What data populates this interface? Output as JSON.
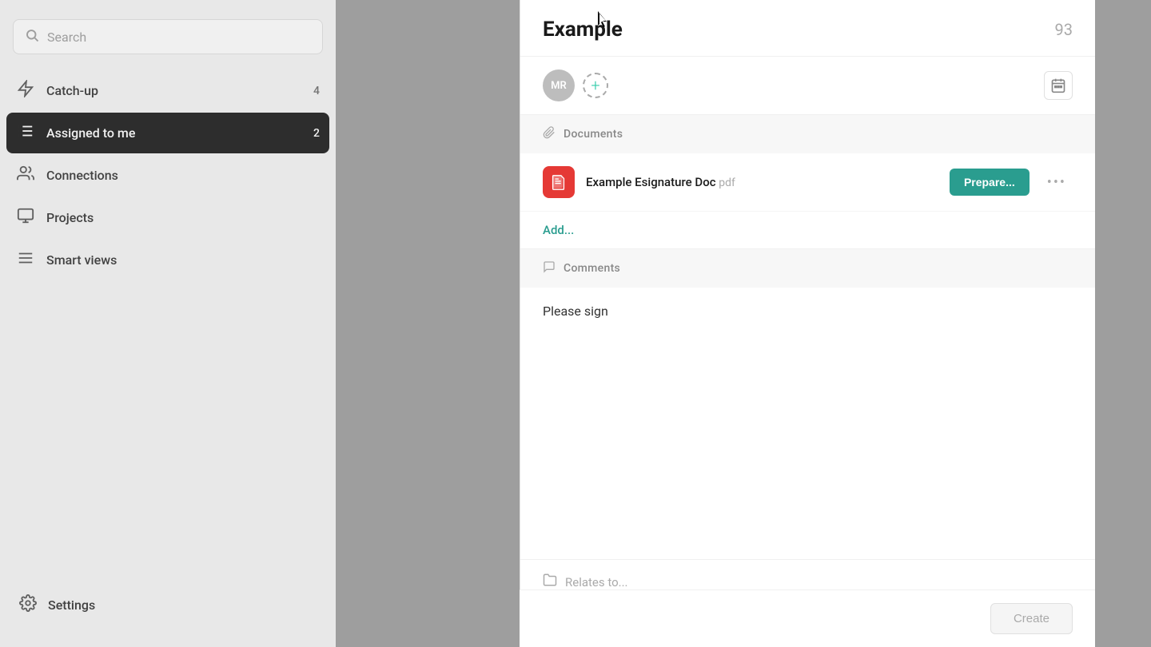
{
  "sidebar": {
    "search": {
      "placeholder": "Search"
    },
    "nav": [
      {
        "id": "catchup",
        "label": "Catch-up",
        "count": "4",
        "active": false,
        "icon": "⚡"
      },
      {
        "id": "assigned",
        "label": "Assigned to me",
        "count": "2",
        "active": true,
        "icon": "☰"
      },
      {
        "id": "connections",
        "label": "Connections",
        "count": "",
        "active": false,
        "icon": "👥"
      },
      {
        "id": "projects",
        "label": "Projects",
        "count": "",
        "active": false,
        "icon": "🗂"
      },
      {
        "id": "smartviews",
        "label": "Smart views",
        "count": "",
        "active": false,
        "icon": "≡"
      }
    ],
    "settings": {
      "label": "Settings",
      "icon": "⚙"
    }
  },
  "panel": {
    "title": "Example",
    "count": "93",
    "members": [
      {
        "initials": "MR"
      }
    ],
    "add_member_icon": "+",
    "calendar_icon": "▦",
    "sections": {
      "documents": {
        "label": "Documents",
        "icon": "📎",
        "items": [
          {
            "name": "Example Esignature Doc",
            "ext": "pdf",
            "prepare_label": "Prepare...",
            "more_icon": "•••"
          }
        ],
        "add_label": "Add..."
      },
      "comments": {
        "label": "Comments",
        "icon": "💬",
        "text": "Please sign"
      },
      "relates": {
        "label": "Relates to...",
        "icon": "📁"
      }
    },
    "plus_icon": "+",
    "create_label": "Create"
  }
}
